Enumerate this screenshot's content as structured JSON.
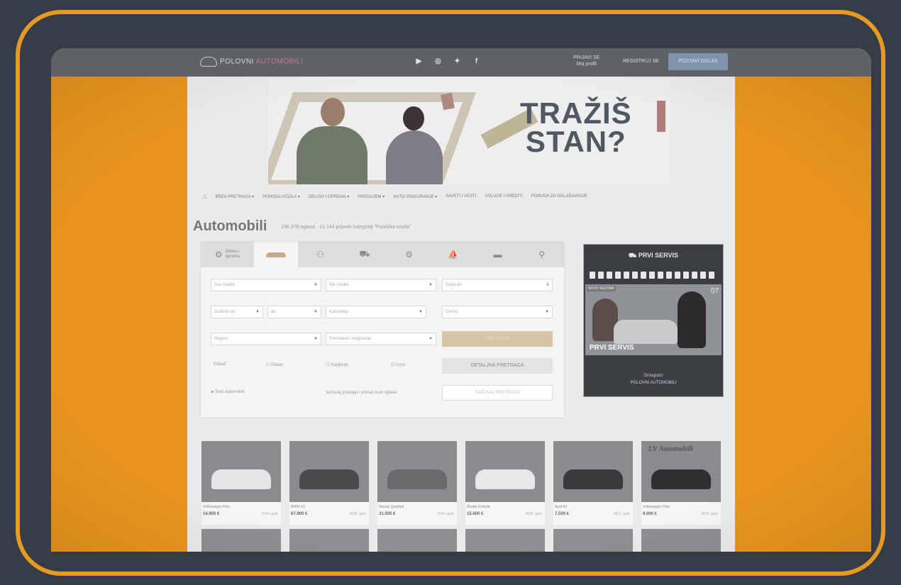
{
  "header": {
    "logo_main": "POLOVNI",
    "logo_accent": "AUTOMOBILI",
    "socials": [
      "▶",
      "◎",
      "✦",
      "f"
    ],
    "login_line1": "PRIJAVI SE",
    "login_line2": "Moj profil",
    "register": "REGISTRUJ SE",
    "post_button": "POSTAVI OGLAS"
  },
  "banner": {
    "line1": "TRAŽIŠ",
    "line2": "STAN?"
  },
  "nav": {
    "home_icon": "home-icon",
    "items": [
      "BRZA PRETRAGA ▾",
      "PONUDA VOZILA ▾",
      "DELOVI I OPREMA ▾",
      "PRODAJEM ▾",
      "AUTO OSIGURANJE ▾",
      "SAVETI I VESTI",
      "USLUGE I KREDITI",
      "PONUDA ZA OGLAŠAVANJE"
    ]
  },
  "page": {
    "title": "Automobili",
    "subtitle": "196.378 oglasa · 10.144 prijavlo kategoriji \"Putnička vozila\""
  },
  "search": {
    "tab_first_label_1": "Delovi i",
    "tab_first_label_2": "oprema",
    "tabs_icons": [
      "car-icon",
      "motorcycle-icon",
      "scooter-icon",
      "tractor-icon",
      "boat-icon",
      "ship-icon",
      "bicycle-icon"
    ],
    "row1": [
      "Sve marke",
      "Svi modeli",
      "Cena do"
    ],
    "row2": [
      "Godište od",
      "do",
      "Karoserija",
      "Gorivo"
    ],
    "row3": [
      "Region",
      "Pokrivena / osiguranje"
    ],
    "search_button": "PRETRAGA",
    "checks": [
      "Ekipaž",
      "Ostalo",
      "Kupljenje",
      "Uvoz"
    ],
    "detailed_button": "DETALJNA PRETRAGA",
    "left_bottom": "Stari automobili",
    "save_text": "Sačuvaj pretragu i primaj nove oglase",
    "save_button": "SAČUVAJ PRETRAGU"
  },
  "ad": {
    "title": "PRVI SERVIS",
    "badge": "NOVO SEZONA",
    "number": "07",
    "servis": "PRVI SERVIS",
    "foot_line1": "Omogućio",
    "foot_line2": "POLOVNI AUTOMOBILI"
  },
  "listings": [
    {
      "name": "Volkswagen Polo",
      "price": "14.900 €",
      "year": "2019. god.",
      "color": "#e6e6e6"
    },
    {
      "name": "BMW X3",
      "price": "67.900 €",
      "year": "2020. god.",
      "color": "#4a4a4a"
    },
    {
      "name": "Nissan Qashqai",
      "price": "31.500 €",
      "year": "2019. god.",
      "color": "#6a6a6a"
    },
    {
      "name": "Škoda Octavia",
      "price": "15.600 €",
      "year": "2020. god.",
      "color": "#e8e8e8"
    },
    {
      "name": "Audi A3",
      "price": "7.500 €",
      "year": "2011. god.",
      "color": "#3a3a3a"
    },
    {
      "name": "Volkswagen Polo",
      "price": "8.000 €",
      "year": "2013. god.",
      "color": "#2f2f2f",
      "brand": "LV Automobili"
    }
  ]
}
